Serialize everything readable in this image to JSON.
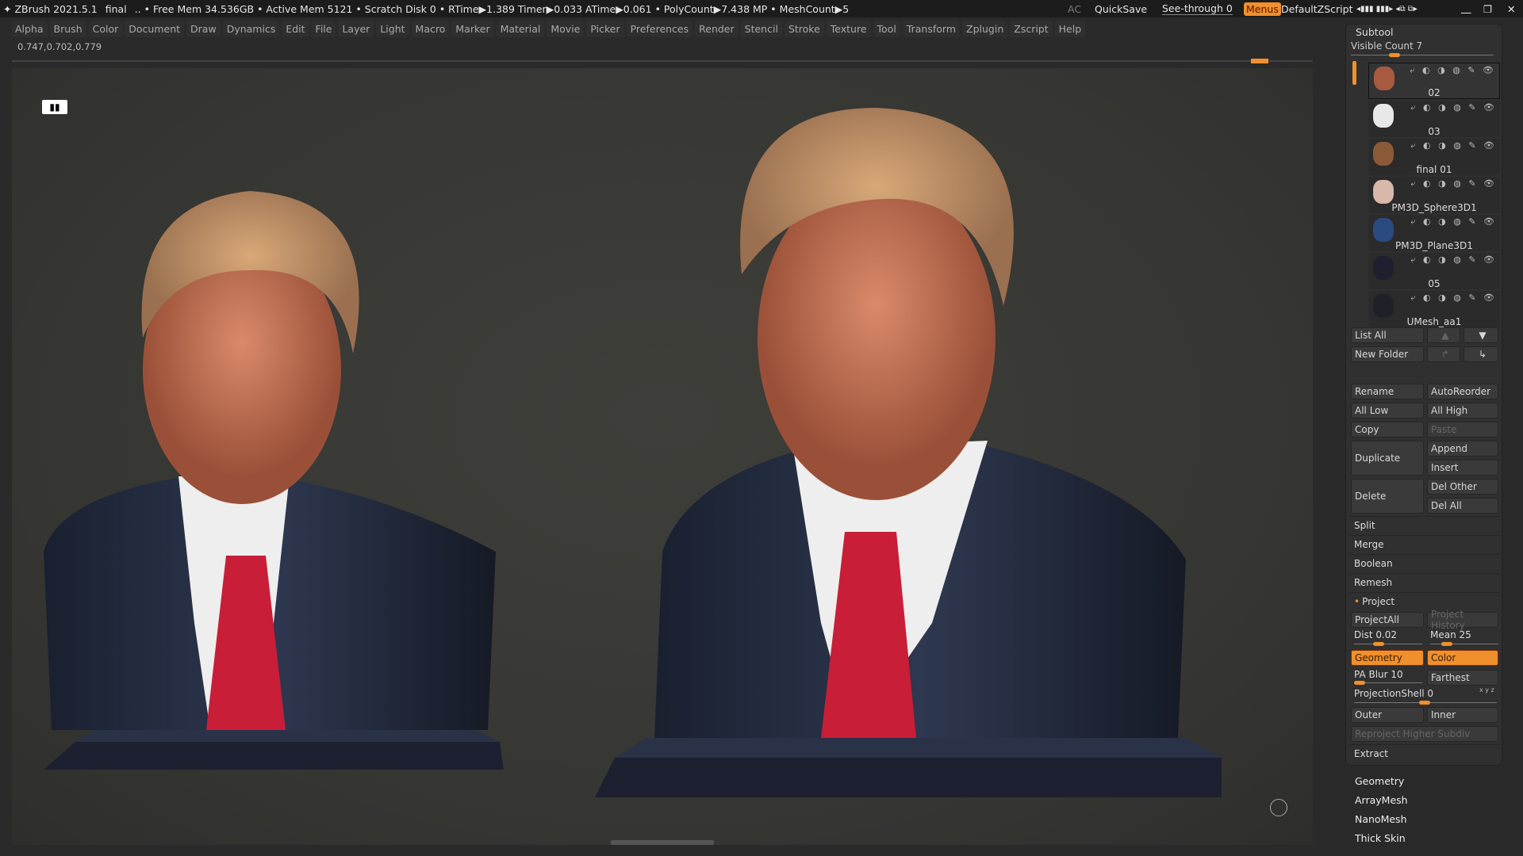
{
  "topbar": {
    "app": "ZBrush 2021.5.1",
    "doc": "final",
    "status": ".. • Free Mem 34.536GB • Active Mem 5121 • Scratch Disk 0 •  RTime▶1.389 Timer▶0.033 ATime▶0.061 • PolyCount▶7.438 MP  • MeshCount▶5",
    "ac": "AC",
    "quicksave": "QuickSave",
    "seethrough": "See-through  0",
    "menus": "Menus",
    "script": "DefaultZScript"
  },
  "menus": [
    "Alpha",
    "Brush",
    "Color",
    "Document",
    "Draw",
    "Dynamics",
    "Edit",
    "File",
    "Layer",
    "Light",
    "Macro",
    "Marker",
    "Material",
    "Movie",
    "Picker",
    "Preferences",
    "Render",
    "Stencil",
    "Stroke",
    "Texture",
    "Tool",
    "Transform",
    "Zplugin",
    "Zscript",
    "Help"
  ],
  "coords": "0.747,0.702,0.779",
  "subtool": {
    "title": "Subtool",
    "visible_count": "Visible Count 7",
    "items": [
      {
        "name": "02",
        "thumb": "#a85a40"
      },
      {
        "name": "03",
        "thumb": "#e8e8e8"
      },
      {
        "name": "final 01",
        "thumb": "#8a5a38"
      },
      {
        "name": "PM3D_Sphere3D1",
        "thumb": "#d8b8a8"
      },
      {
        "name": "PM3D_Plane3D1",
        "thumb": "#2a4a80"
      },
      {
        "name": "05",
        "thumb": "#1e2030"
      },
      {
        "name": "UMesh_aa1",
        "thumb": "#202028"
      }
    ],
    "list_all": "List All",
    "new_folder": "New Folder",
    "rename": "Rename",
    "autoreorder": "AutoReorder",
    "all_low": "All Low",
    "all_high": "All High",
    "copy": "Copy",
    "paste": "Paste",
    "duplicate": "Duplicate",
    "append": "Append",
    "insert": "Insert",
    "delete": "Delete",
    "del_other": "Del Other",
    "del_all": "Del All",
    "split": "Split",
    "merge": "Merge",
    "boolean": "Boolean",
    "remesh": "Remesh",
    "project": "Project",
    "projectall": "ProjectAll",
    "project_history": "Project History",
    "dist": "Dist 0.02",
    "mean": "Mean 25",
    "geometry": "Geometry",
    "color": "Color",
    "pa_blur": "PA Blur 10",
    "farthest": "Farthest",
    "projection_shell": "ProjectionShell 0",
    "xyz": "x y z",
    "outer": "Outer",
    "inner": "Inner",
    "reproject": "Reproject Higher Subdiv",
    "extract": "Extract"
  },
  "subpalettes": [
    "Geometry",
    "ArrayMesh",
    "NanoMesh",
    "Thick Skin"
  ],
  "colors": {
    "accent": "#f0902c",
    "viewport": "#3a3a36"
  }
}
